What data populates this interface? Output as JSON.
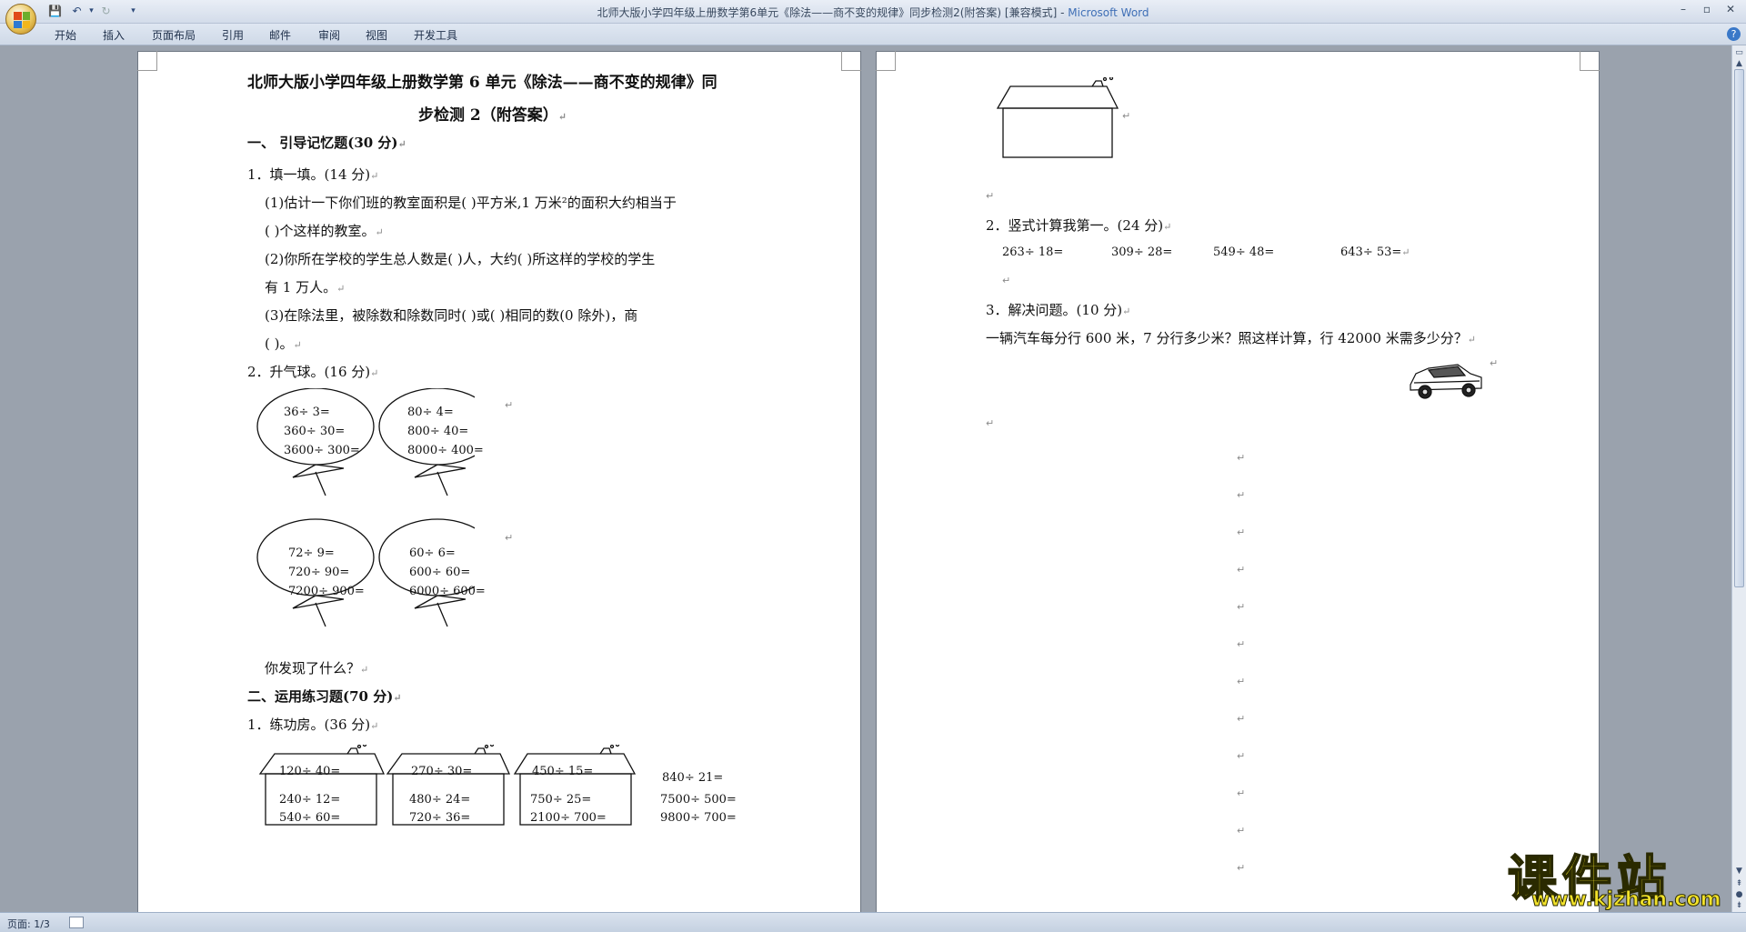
{
  "window": {
    "title": "北师大版小学四年级上册数学第6单元《除法——商不变的规律》同步检测2(附答案) [兼容模式] - ",
    "app_name": "Microsoft Word"
  },
  "menu": [
    "开始",
    "插入",
    "页面布局",
    "引用",
    "邮件",
    "审阅",
    "视图",
    "开发工具"
  ],
  "status": {
    "page": "页面: 1/3"
  },
  "page1": {
    "title_line1": "北师大版小学四年级上册数学第 6 单元《除法——商不变的规律》同",
    "title_line2": "步检测 2（附答案）",
    "sec1": "一、    引导记忆题(30 分)",
    "q1": "1．填一填。(14 分)",
    "q1_1a": "(1)估计一下你们班的教室面积是(       )平方米,1 万米²的面积大约相当于",
    "q1_1b": "(       )个这样的教室。",
    "q1_2a": "(2)你所在学校的学生总人数是(       )人，大约(       )所这样的学校的学生",
    "q1_2b": "有 1 万人。",
    "q1_3a": "(3)在除法里，被除数和除数同时(       )或(       )相同的数(0 除外)，商",
    "q1_3b": "(         )。",
    "q2": "2．升气球。(16 分)",
    "balloons": [
      [
        "36÷ 3=",
        "360÷ 30=",
        "3600÷ 300="
      ],
      [
        "80÷ 4=",
        "800÷ 40=",
        "8000÷ 400="
      ],
      [
        "72÷ 9=",
        "720÷ 90=",
        "7200÷ 900="
      ],
      [
        "60÷ 6=",
        "600÷ 60=",
        "6000÷ 600="
      ]
    ],
    "discover": "你发现了什么？",
    "sec2": "二、运用练习题(70 分)",
    "q3": "1．练功房。(36 分)",
    "houses": [
      [
        "120÷ 40=",
        "240÷ 12=",
        "540÷ 60="
      ],
      [
        "270÷ 30=",
        "480÷ 24=",
        "720÷ 36="
      ],
      [
        "450÷ 15=",
        "750÷ 25=",
        "2100÷ 700="
      ]
    ],
    "extra": [
      "840÷ 21=",
      "7500÷ 500=",
      "9800÷ 700="
    ]
  },
  "page2": {
    "q4": "2．竖式计算我第一。(24 分)",
    "calcs": [
      "263÷ 18=",
      "309÷ 28=",
      "549÷ 48=",
      "643÷ 53="
    ],
    "q5": "3．解决问题。(10 分)",
    "problem": "一辆汽车每分行 600 米，7 分行多少米？照这样计算，行 42000 米需多少分？"
  },
  "marks": {
    "para": "↵"
  },
  "watermark": {
    "text": "课件站",
    "url": "www.kjzhan.com"
  },
  "colors": {
    "accent": "#3f6fb6",
    "watermark": "#f2e22a"
  }
}
